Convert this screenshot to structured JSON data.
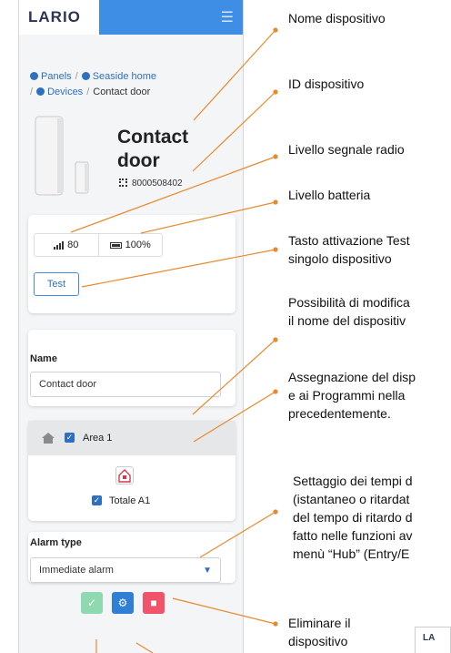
{
  "app": {
    "logo": "LARIO",
    "menu_icon": "hamburger-icon"
  },
  "breadcrumb": {
    "panels": "Panels",
    "home": "Seaside home",
    "devices": "Devices",
    "current": "Contact door",
    "separator": "/"
  },
  "device": {
    "title": "Contact door",
    "id": "8000508402",
    "signal": "80",
    "battery": "100%",
    "test_label": "Test"
  },
  "form": {
    "name_label": "Name",
    "name_value": "Contact door",
    "area_name": "Area 1",
    "program_name": "Totale A1",
    "alarm_type_label": "Alarm type",
    "alarm_type_value": "Immediate alarm"
  },
  "annotations": {
    "nome": "Nome dispositivo",
    "id": "ID dispositivo",
    "segnale": "Livello segnale radio",
    "batteria": "Livello batteria",
    "test_1": "Tasto attivazione Test",
    "test_2": "singolo dispositivo",
    "modifica_1": "Possibilità di modifica",
    "modifica_2": "il nome del dispositiv",
    "assegna_1": "Assegnazione del disp",
    "assegna_2": "e ai Programmi nella",
    "assegna_3": "precedentemente.",
    "tempi_1": "Settaggio dei tempi d",
    "tempi_2": "(istantaneo o ritardat",
    "tempi_3": "del tempo di ritardo d",
    "tempi_4": "fatto nelle funzioni av",
    "tempi_5": "menù “Hub” (Entry/E",
    "elimina_1": "Eliminare il",
    "elimina_2": "dispositivo",
    "thumb_logo": "LA"
  },
  "colors": {
    "accent": "#3f8ee6",
    "leader": "#e8892e",
    "confirm": "#8fd9b0",
    "settings": "#2f7fd6",
    "delete": "#f0536a"
  }
}
